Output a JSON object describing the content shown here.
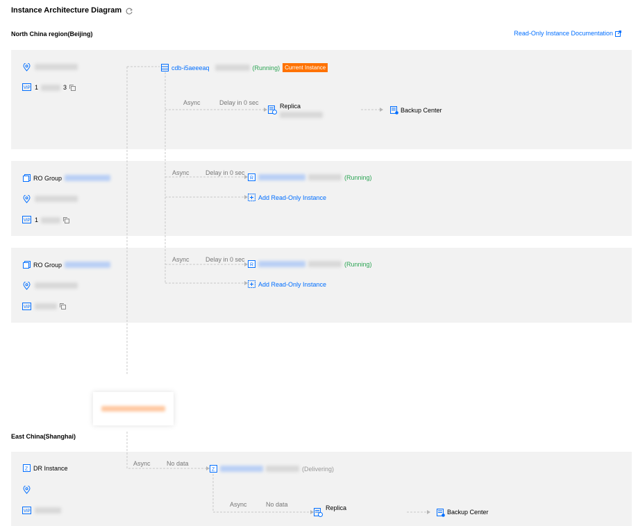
{
  "header": {
    "title": "Instance Architecture Diagram",
    "doc_link": "Read-Only Instance Documentation"
  },
  "north": {
    "region_title": "North China region(Beijing)",
    "master": {
      "vip_partial": "1",
      "vip_partial_end": "3",
      "instance_id": "cdb-i5aeeeaq",
      "status": "(Running)",
      "badge": "Current Instance",
      "async_label": "Async",
      "delay_label": "Delay in 0 sec",
      "replica_label": "Replica",
      "backup_label": "Backup Center"
    },
    "ro_groups": [
      {
        "group_label": "RO Group",
        "vip_partial": "1",
        "async_label": "Async",
        "delay_label": "Delay in 0 sec",
        "status": "(Running)",
        "add_label": "Add Read-Only Instance"
      },
      {
        "group_label": "RO Group",
        "async_label": "Async",
        "delay_label": "Delay in 0 sec",
        "status": "(Running)",
        "add_label": "Add Read-Only Instance"
      }
    ]
  },
  "east": {
    "region_title": "East China(Shanghai)",
    "dr_label": "DR Instance",
    "async_label": "Async",
    "nodata_label": "No data",
    "status": "(Delivering)",
    "replica_async": "Async",
    "replica_nodata": "No data",
    "replica_label": "Replica",
    "backup_label": "Backup Center"
  },
  "colors": {
    "link": "#006eff",
    "running": "#29a352",
    "badge": "#ff7200",
    "panel": "#f2f2f2"
  }
}
